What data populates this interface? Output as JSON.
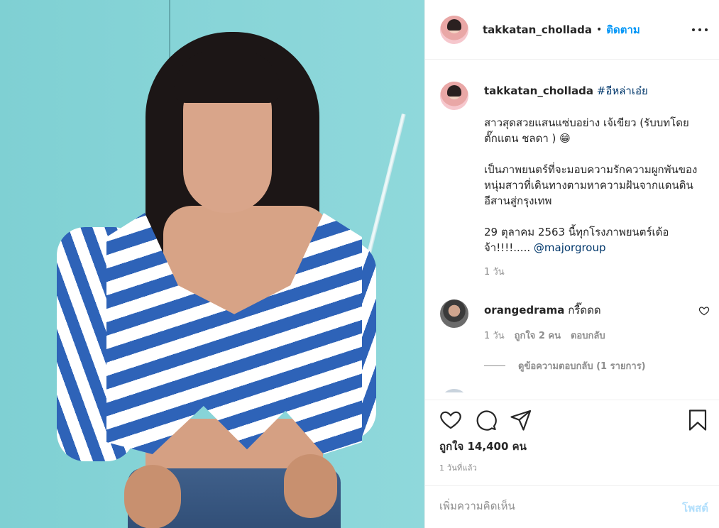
{
  "post": {
    "photo_alt": "photo"
  },
  "header": {
    "username": "takkatan_chollada",
    "separator": "•",
    "follow_label": "ติดตาม"
  },
  "caption": {
    "username": "takkatan_chollada",
    "hashtag": "#อีหล่าเอ๋ย",
    "paragraph1": "สาวสุดสวยแสนแซ่บอย่าง เจ้เขียว (รับบทโดย ตั๊กแตน ชลดา ) 😁",
    "paragraph2": "เป็นภาพยนตร์ที่จะมอบความรักความผูกพันของหนุ่มสาวที่เดินทางตามหาความฝันจากแดนดินอีสานสู่กรุงเทพ",
    "paragraph3_text": "29 ตุลาคม 2563 นี้ทุกโรงภาพยนตร์เด้อจ้า!!!!.....",
    "paragraph3_mention": "@majorgroup",
    "time": "1 วัน"
  },
  "comments": [
    {
      "username": "orangedrama",
      "text": "กรี๊ดดด",
      "time": "1 วัน",
      "likes": "ถูกใจ 2 คน",
      "reply_label": "ตอบกลับ",
      "view_replies": "ดูข้อความตอบกลับ (1 รายการ)"
    }
  ],
  "actions": {
    "like_icon": "heart-icon",
    "comment_icon": "comment-icon",
    "share_icon": "paper-plane-icon",
    "save_icon": "bookmark-icon",
    "likes_count": "ถูกใจ 14,400 คน",
    "posted_time": "1 วันที่แล้ว"
  },
  "add_comment": {
    "placeholder": "เพิ่มความคิดเห็น",
    "value": "",
    "post_label": "โพสต์"
  },
  "colors": {
    "accent": "#0095f6",
    "post_disabled": "#b2dffc",
    "secondary_text": "#8e8e8e",
    "link": "#00376b"
  }
}
